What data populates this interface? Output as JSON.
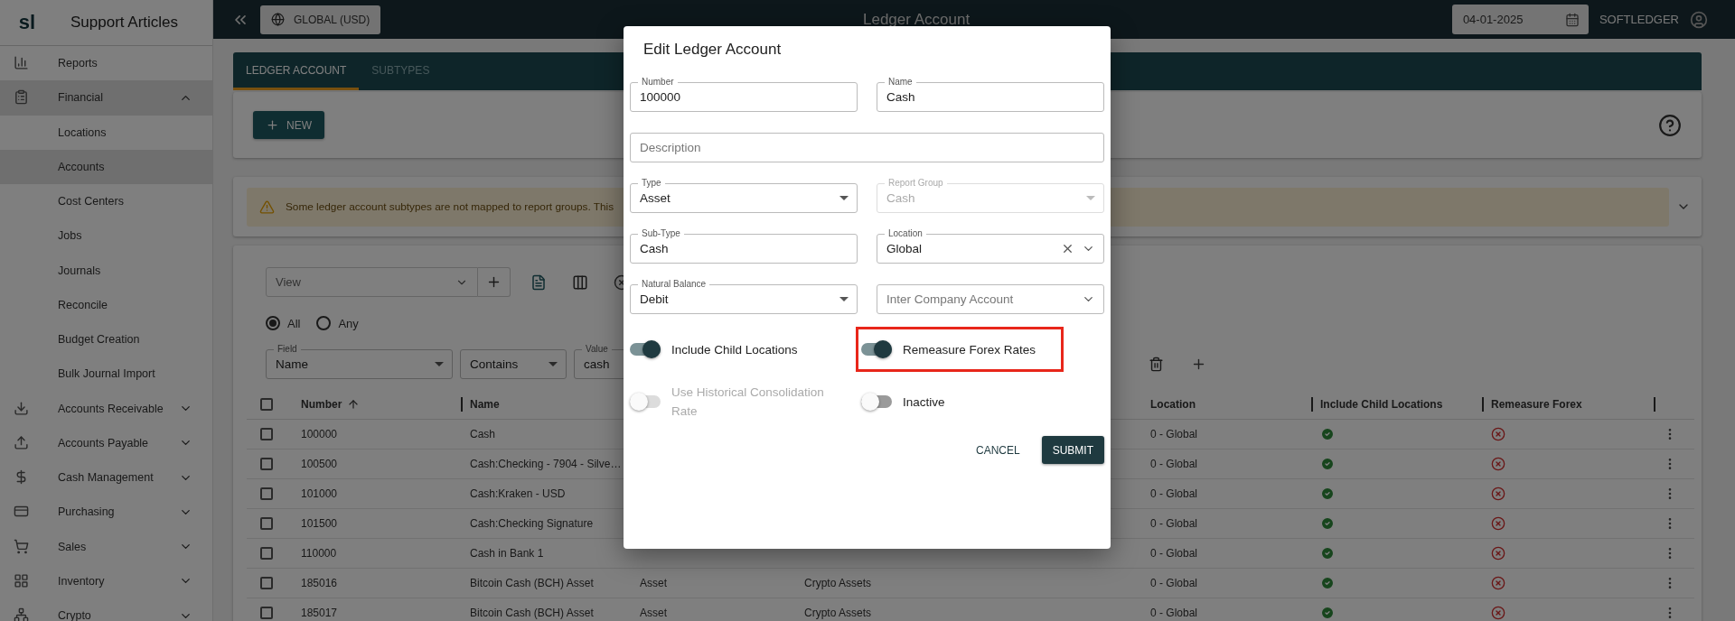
{
  "sidebar": {
    "logo": "sl",
    "title": "Support Articles",
    "items": [
      {
        "label": "Reports",
        "selected": false
      },
      {
        "label": "Financial",
        "selected": true,
        "expanded": true,
        "children": [
          {
            "label": "Locations",
            "selected": false
          },
          {
            "label": "Accounts",
            "selected": true
          },
          {
            "label": "Cost Centers",
            "selected": false
          },
          {
            "label": "Jobs",
            "selected": false
          },
          {
            "label": "Journals",
            "selected": false
          },
          {
            "label": "Reconcile",
            "selected": false
          },
          {
            "label": "Budget Creation",
            "selected": false
          },
          {
            "label": "Bulk Journal Import",
            "selected": false
          }
        ]
      },
      {
        "label": "Accounts Receivable",
        "selected": false,
        "expanded": false
      },
      {
        "label": "Accounts Payable",
        "selected": false,
        "expanded": false
      },
      {
        "label": "Cash Management",
        "selected": false,
        "expanded": false
      },
      {
        "label": "Purchasing",
        "selected": false,
        "expanded": false
      },
      {
        "label": "Sales",
        "selected": false,
        "expanded": false
      },
      {
        "label": "Inventory",
        "selected": false,
        "expanded": false
      },
      {
        "label": "Crypto",
        "selected": false,
        "expanded": false
      }
    ]
  },
  "topbar": {
    "entity_button": "GLOBAL (USD)",
    "title": "Ledger Account",
    "date": "04-01-2025",
    "user": "SOFTLEDGER"
  },
  "tabs": [
    {
      "label": "LEDGER ACCOUNT",
      "selected": true
    },
    {
      "label": "SUBTYPES",
      "selected": false
    }
  ],
  "new_button": "NEW",
  "alert": "Some ledger account subtypes are not mapped to report groups. This",
  "filters": {
    "view_placeholder": "View",
    "match": [
      {
        "label": "All",
        "selected": true
      },
      {
        "label": "Any",
        "selected": false
      }
    ],
    "field": {
      "label": "Field",
      "value": "Name"
    },
    "operator": {
      "value": "Contains"
    },
    "value": {
      "label": "Value",
      "value": "cash"
    }
  },
  "table": {
    "header_checked": false,
    "columns": [
      {
        "label": "Number",
        "sort_ascending": true
      },
      {
        "label": "Name"
      },
      {
        "label": "Location"
      },
      {
        "label": "Include Child Locations"
      },
      {
        "label": "Remeasure Forex"
      }
    ],
    "rows": [
      {
        "number": "100000",
        "name": "Cash",
        "location": "0 - Global",
        "include_child": true,
        "remeasure": false,
        "selected": false
      },
      {
        "number": "100500",
        "name": "Cash:Checking - 7904 - Silve…",
        "location": "0 - Global",
        "include_child": true,
        "remeasure": false,
        "selected": false
      },
      {
        "number": "101000",
        "name": "Cash:Kraken - USD",
        "location": "0 - Global",
        "include_child": true,
        "remeasure": false,
        "selected": false
      },
      {
        "number": "101500",
        "name": "Cash:Checking Signature",
        "location": "0 - Global",
        "include_child": true,
        "remeasure": false,
        "selected": false
      },
      {
        "number": "110000",
        "name": "Cash in Bank 1",
        "location": "0 - Global",
        "include_child": true,
        "remeasure": false,
        "selected": false
      },
      {
        "number": "185016",
        "name": "Bitcoin Cash (BCH) Asset",
        "type": "Asset",
        "subtype": "Crypto Assets",
        "location": "0 - Global",
        "include_child": true,
        "remeasure": false,
        "selected": false
      },
      {
        "number": "185017",
        "name": "Bitcoin Cash (BCH) Asset",
        "type": "Asset",
        "subtype": "Crypto Assets",
        "location": "0 - Global",
        "include_child": true,
        "remeasure": false,
        "selected": false
      }
    ]
  },
  "dialog": {
    "title": "Edit Ledger Account",
    "fields": [
      {
        "kind": "text",
        "label": "Number",
        "value": "100000"
      },
      {
        "kind": "text",
        "label": "Name",
        "value": "Cash"
      },
      {
        "kind": "text",
        "placeholder": "Description"
      },
      {
        "kind": "select",
        "label": "Type",
        "value": "Asset"
      },
      {
        "kind": "select",
        "label": "Report Group",
        "value": "Cash",
        "disabled": true
      },
      {
        "kind": "text",
        "label": "Sub-Type",
        "value": "Cash"
      },
      {
        "kind": "autocomplete",
        "label": "Location",
        "value": "Global"
      },
      {
        "kind": "select",
        "label": "Natural Balance",
        "value": "Debit"
      },
      {
        "kind": "autocomplete",
        "placeholder": "Inter Company Account"
      }
    ],
    "toggles": [
      {
        "label": "Include Child Locations",
        "on": true,
        "disabled": false,
        "highlighted": false
      },
      {
        "label": "Remeasure Forex Rates",
        "on": true,
        "disabled": false,
        "highlighted": true
      },
      {
        "label": "Use Historical Consolidation Rate",
        "on": false,
        "disabled": true,
        "highlighted": false
      },
      {
        "label": "Inactive",
        "on": false,
        "disabled": false,
        "highlighted": false
      }
    ],
    "buttons": [
      {
        "kind": "text",
        "label": "CANCEL"
      },
      {
        "kind": "primary",
        "label": "SUBMIT"
      }
    ]
  }
}
